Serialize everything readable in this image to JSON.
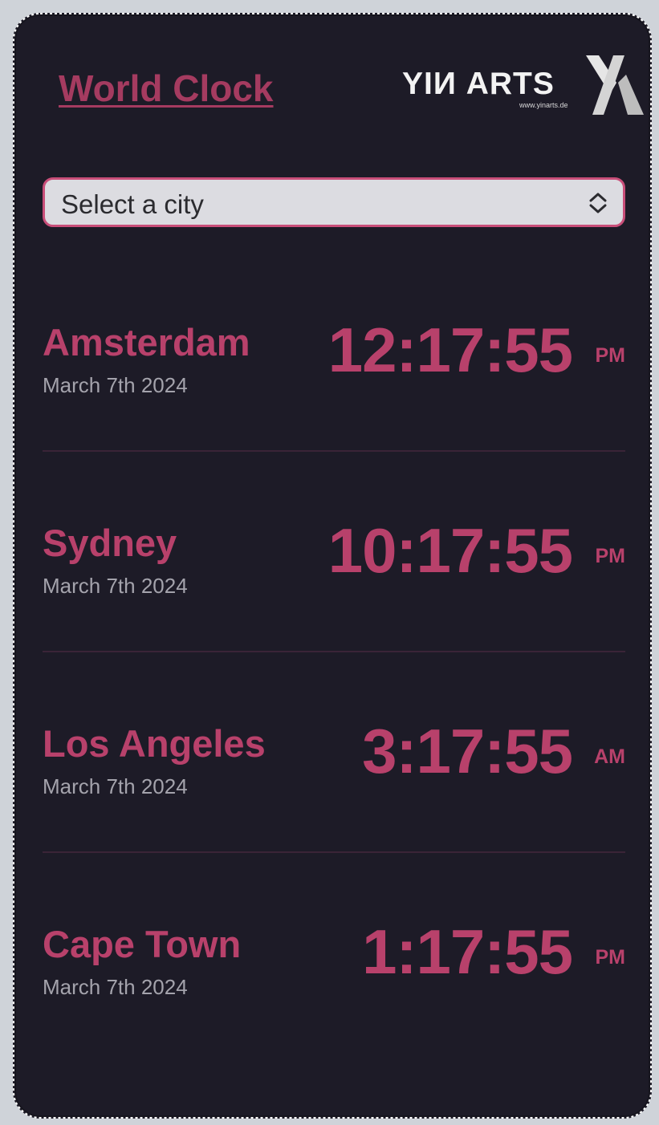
{
  "app": {
    "title": "World Clock"
  },
  "logo": {
    "text": "YIИ ARTS",
    "url_text": "www.yinarts.de",
    "mark_icon": "yinarts-logo-mark"
  },
  "city_select": {
    "value": "Select a city",
    "icon": "chevron-up-down-icon"
  },
  "clocks": [
    {
      "city": "Amsterdam",
      "date": "March 7th 2024",
      "time": "12:17:55",
      "ampm": "PM"
    },
    {
      "city": "Sydney",
      "date": "March 7th 2024",
      "time": "10:17:55",
      "ampm": "PM"
    },
    {
      "city": "Los Angeles",
      "date": "March 7th 2024",
      "time": "3:17:55",
      "ampm": "AM"
    },
    {
      "city": "Cape Town",
      "date": "March 7th 2024",
      "time": "1:17:55",
      "ampm": "PM"
    }
  ],
  "colors": {
    "background": "#1d1b27",
    "accent": "#b8416b",
    "select_background": "#dcdce1",
    "muted_text": "#a4a3ac"
  }
}
